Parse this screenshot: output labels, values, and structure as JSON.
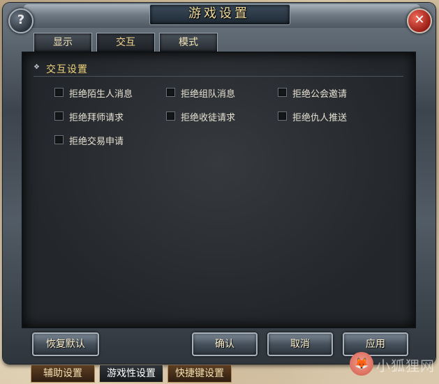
{
  "window": {
    "title": "游戏设置",
    "help_glyph": "?",
    "close_glyph": "✕"
  },
  "top_tabs": [
    {
      "label": "显示",
      "active": false
    },
    {
      "label": "交互",
      "active": true
    },
    {
      "label": "模式",
      "active": false
    }
  ],
  "section": {
    "title": "交互设置",
    "options": [
      {
        "label": "拒绝陌生人消息",
        "checked": false
      },
      {
        "label": "拒绝组队消息",
        "checked": false
      },
      {
        "label": "拒绝公会邀请",
        "checked": false
      },
      {
        "label": "拒绝拜师请求",
        "checked": false
      },
      {
        "label": "拒绝收徒请求",
        "checked": false
      },
      {
        "label": "拒绝仇人推送",
        "checked": false
      },
      {
        "label": "拒绝交易申请",
        "checked": false
      }
    ]
  },
  "buttons": {
    "restore_default": "恢复默认",
    "confirm": "确认",
    "cancel": "取消",
    "apply": "应用"
  },
  "bottom_tabs": [
    {
      "label": "辅助设置",
      "active": false
    },
    {
      "label": "游戏性设置",
      "active": true
    },
    {
      "label": "快捷键设置",
      "active": false
    }
  ],
  "watermark": {
    "text": "小狐狸网",
    "icon": "fox-icon"
  },
  "colors": {
    "title_gold": "#f1dc9c",
    "section_gold": "#f0d57c",
    "panel_dark": "#26292d",
    "close_red": "#c0392b"
  }
}
